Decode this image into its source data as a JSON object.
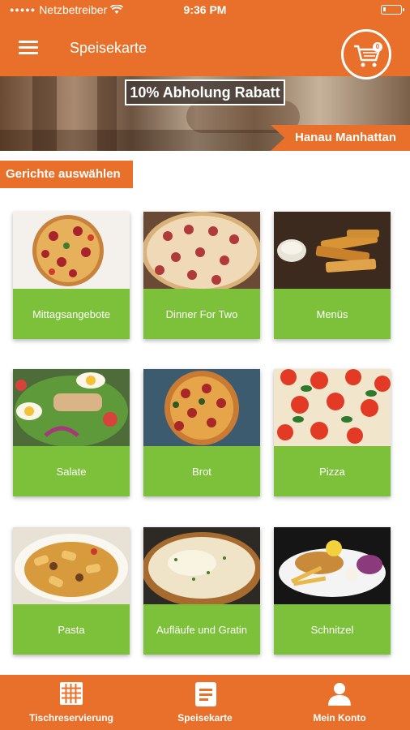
{
  "status": {
    "carrier": "Netzbetreiber",
    "time": "9:36 PM"
  },
  "header": {
    "title": "Speisekarte",
    "cart_count": "0"
  },
  "banner": {
    "promo": "10% Abholung Rabatt",
    "location": "Hanau Manhattan"
  },
  "section": {
    "label": "Gerichte auswählen"
  },
  "categories": [
    {
      "label": "Mittagsangebote"
    },
    {
      "label": "Dinner For Two"
    },
    {
      "label": "Menüs"
    },
    {
      "label": "Salate"
    },
    {
      "label": "Brot"
    },
    {
      "label": "Pizza"
    },
    {
      "label": "Pasta"
    },
    {
      "label": "Aufläufe und Gratin"
    },
    {
      "label": "Schnitzel"
    }
  ],
  "nav": [
    {
      "label": "Tischreservierung",
      "icon": "grid-icon"
    },
    {
      "label": "Speisekarte",
      "icon": "menu-list-icon"
    },
    {
      "label": "Mein Konto",
      "icon": "user-icon"
    }
  ],
  "colors": {
    "accent": "#e8702a",
    "card_label": "#7cc139"
  }
}
